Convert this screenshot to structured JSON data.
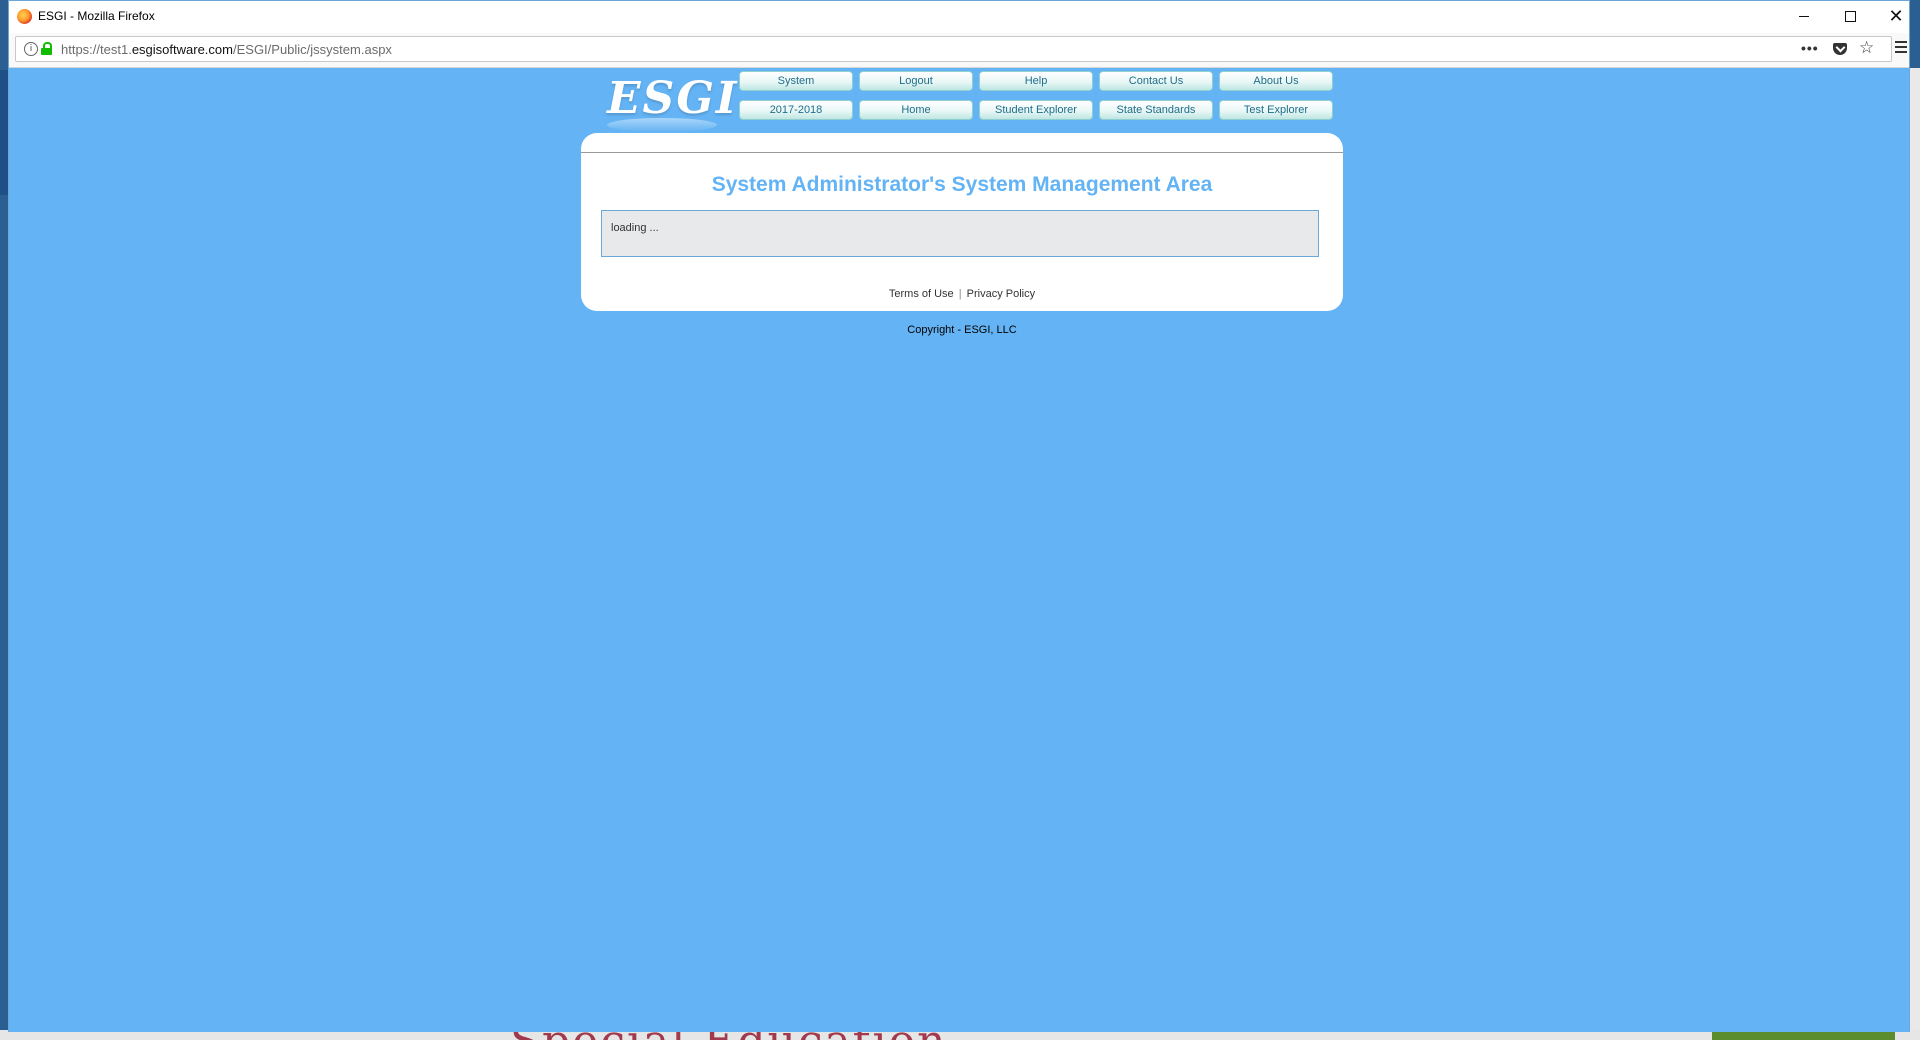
{
  "window": {
    "title": "ESGI - Mozilla Firefox",
    "url_prefix": "https://test1.",
    "url_domain": "esgisoftware.com",
    "url_path": "/ESGI/Public/jssystem.aspx"
  },
  "page": {
    "logo": "ESGI",
    "nav_row1": [
      "System",
      "Logout",
      "Help",
      "Contact Us",
      "About Us"
    ],
    "nav_row2": [
      "2017-2018",
      "Home",
      "Student Explorer",
      "State Standards",
      "Test Explorer"
    ],
    "title": "System Administrator's System Management Area",
    "loading_text": "loading ...",
    "terms_link": "Terms of Use",
    "separator": "|",
    "privacy_link": "Privacy Policy",
    "copyright": "Copyright - ESGI, LLC"
  },
  "background": {
    "desktop_text": "Special Education"
  },
  "colors": {
    "page_background": "#64b3f4",
    "title_color": "#64b3f4",
    "lock_green": "#12bc00"
  }
}
